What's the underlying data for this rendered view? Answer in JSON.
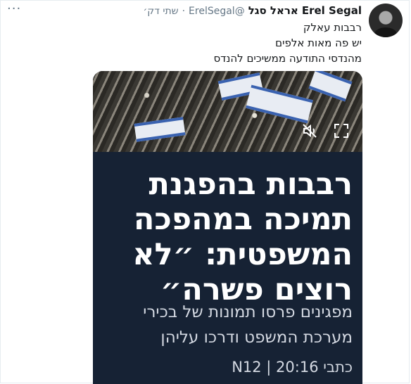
{
  "tweet": {
    "author_name_en": "Erel Segal",
    "author_name_he": "אראל סגל",
    "handle": "@ErelSegal",
    "separator": "·",
    "time": "שתי דק׳",
    "more_label": "···",
    "text_lines": [
      "רבבות עאלק",
      "יש פה מאות אלפים",
      "מהנדסי התודעה ממשיכים להנדס"
    ]
  },
  "media": {
    "headline_lines": [
      "רבבות בהפגנת",
      "תמיכה במהפכה",
      "המשפטית: ״לא",
      "רוצים פשרה״"
    ],
    "subhead_lines": [
      "מפגינים פרסו תמונות של בכירי",
      "מערכת המשפט ודרכו עליהן"
    ],
    "source": "כתבי N12 | 20:16",
    "icons": {
      "mute": "speaker-muted-icon",
      "fullscreen": "fullscreen-icon"
    }
  }
}
